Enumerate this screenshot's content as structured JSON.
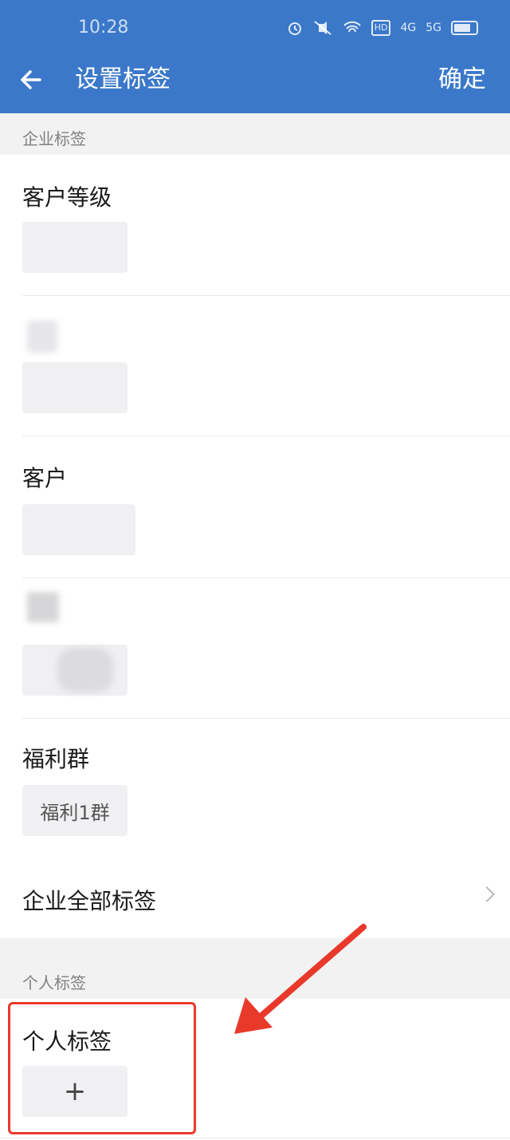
{
  "status_bar": {
    "time": "10:28",
    "icons": [
      "alarm-icon",
      "mute-icon",
      "wifi-icon",
      "hd-icon",
      "4g-signal-icon",
      "5g-signal-icon",
      "battery-icon"
    ],
    "icon_text": {
      "hd": "HD",
      "g4": "4G",
      "g5": "5G"
    }
  },
  "nav": {
    "title": "设置标签",
    "confirm": "确定"
  },
  "enterprise_section": {
    "header": "企业标签",
    "groups": [
      {
        "title": "客户等级"
      },
      {
        "title": ""
      },
      {
        "title": "客户"
      },
      {
        "title": ""
      },
      {
        "title": "福利群",
        "tags": [
          "福利1群"
        ]
      }
    ],
    "all_tags_label": "企业全部标签"
  },
  "personal_section": {
    "header": "个人标签",
    "group_title": "个人标签",
    "add_label": "+"
  },
  "colors": {
    "header_bg": "#3b78c9",
    "annotation": "#e8392b",
    "chip_bg": "#f0f0f3"
  }
}
